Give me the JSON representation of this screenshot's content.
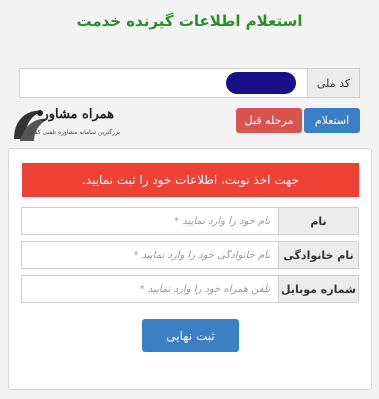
{
  "header": {
    "title": "استعلام اطلاعات گیرنده خدمت"
  },
  "national_code": {
    "label": "کد ملی",
    "value": ""
  },
  "logo": {
    "brand": "همراه مشاور",
    "tagline": "بزرگترین سامانه مشاوره تلفنی کشور"
  },
  "actions": {
    "inquiry_label": "استعلام",
    "prev_step_label": "مرحله قبل"
  },
  "form": {
    "alert_text": "جهت اخذ نوبت، اطلاعات خود را ثبت نمایید.",
    "fields": [
      {
        "label": "نام",
        "placeholder": "نام خود را وارد نمایید *"
      },
      {
        "label": "نام خانوادگی",
        "placeholder": "نام خانوادگی خود را وارد نمایید *"
      },
      {
        "label": "شماره موبایل",
        "placeholder": "تلفن همراه خود را وارد نمایید *"
      }
    ],
    "submit_label": "ثبت نهایی"
  },
  "colors": {
    "title_green": "#2e8b2e",
    "primary_blue": "#3b7fc4",
    "danger_red": "#d9534f",
    "alert_red": "#ef4236",
    "redaction_blue": "#1a0f8a"
  }
}
